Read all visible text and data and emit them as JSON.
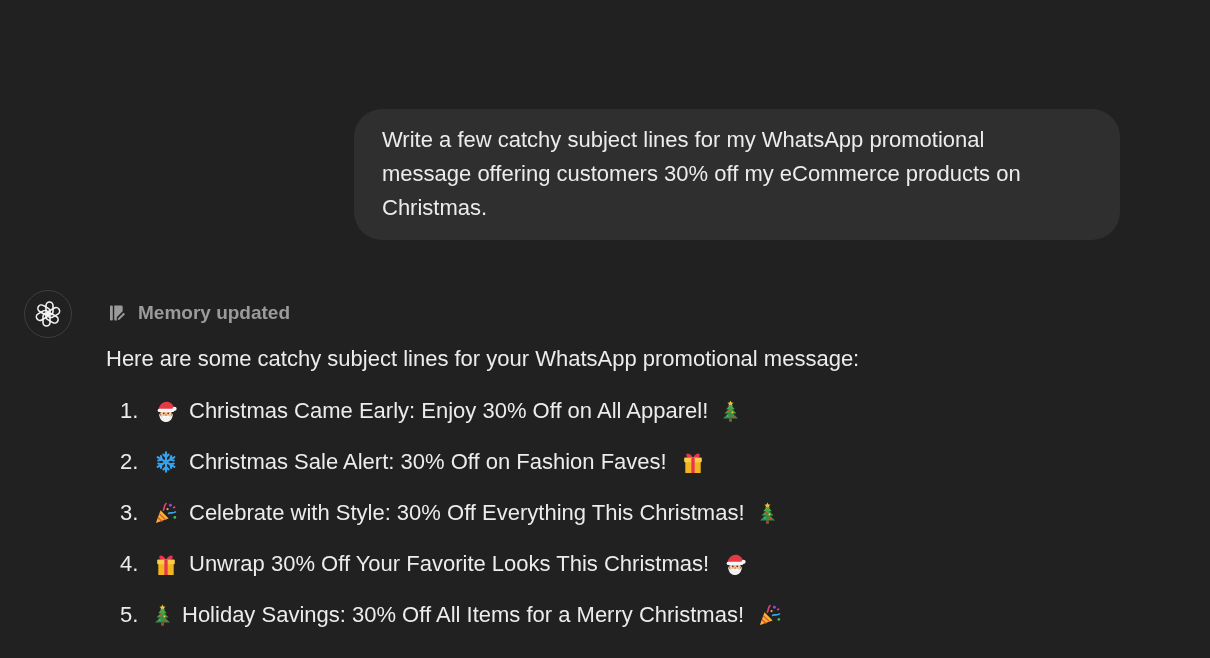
{
  "user_message": {
    "text": "Write a few catchy subject lines for my WhatsApp promotional message offering customers 30% off my eCommerce products on Christmas."
  },
  "assistant_message": {
    "status": "Memory updated",
    "intro": "Here are some catchy subject lines for your WhatsApp promotional message:",
    "subject_lines": [
      {
        "number": "1.",
        "lead_emoji": {
          "kind": "santa"
        },
        "text": "Christmas Came Early: Enjoy 30% Off on All Apparel!",
        "trail_emoji": {
          "kind": "tree"
        }
      },
      {
        "number": "2.",
        "lead_emoji": {
          "kind": "snowflake"
        },
        "text": "Christmas Sale Alert: 30% Off on Fashion Faves!",
        "trail_emoji": {
          "kind": "gift"
        }
      },
      {
        "number": "3.",
        "lead_emoji": {
          "kind": "popper"
        },
        "text": "Celebrate with Style: 30% Off Everything This Christmas!",
        "trail_emoji": {
          "kind": "tree"
        }
      },
      {
        "number": "4.",
        "lead_emoji": {
          "kind": "gift"
        },
        "text": "Unwrap 30% Off Your Favorite Looks This Christmas!",
        "trail_emoji": {
          "kind": "santa"
        }
      },
      {
        "number": "5.",
        "lead_emoji": {
          "kind": "tree"
        },
        "text": "Holiday Savings: 30% Off All Items for a Merry Christmas!",
        "trail_emoji": {
          "kind": "popper"
        }
      }
    ]
  }
}
